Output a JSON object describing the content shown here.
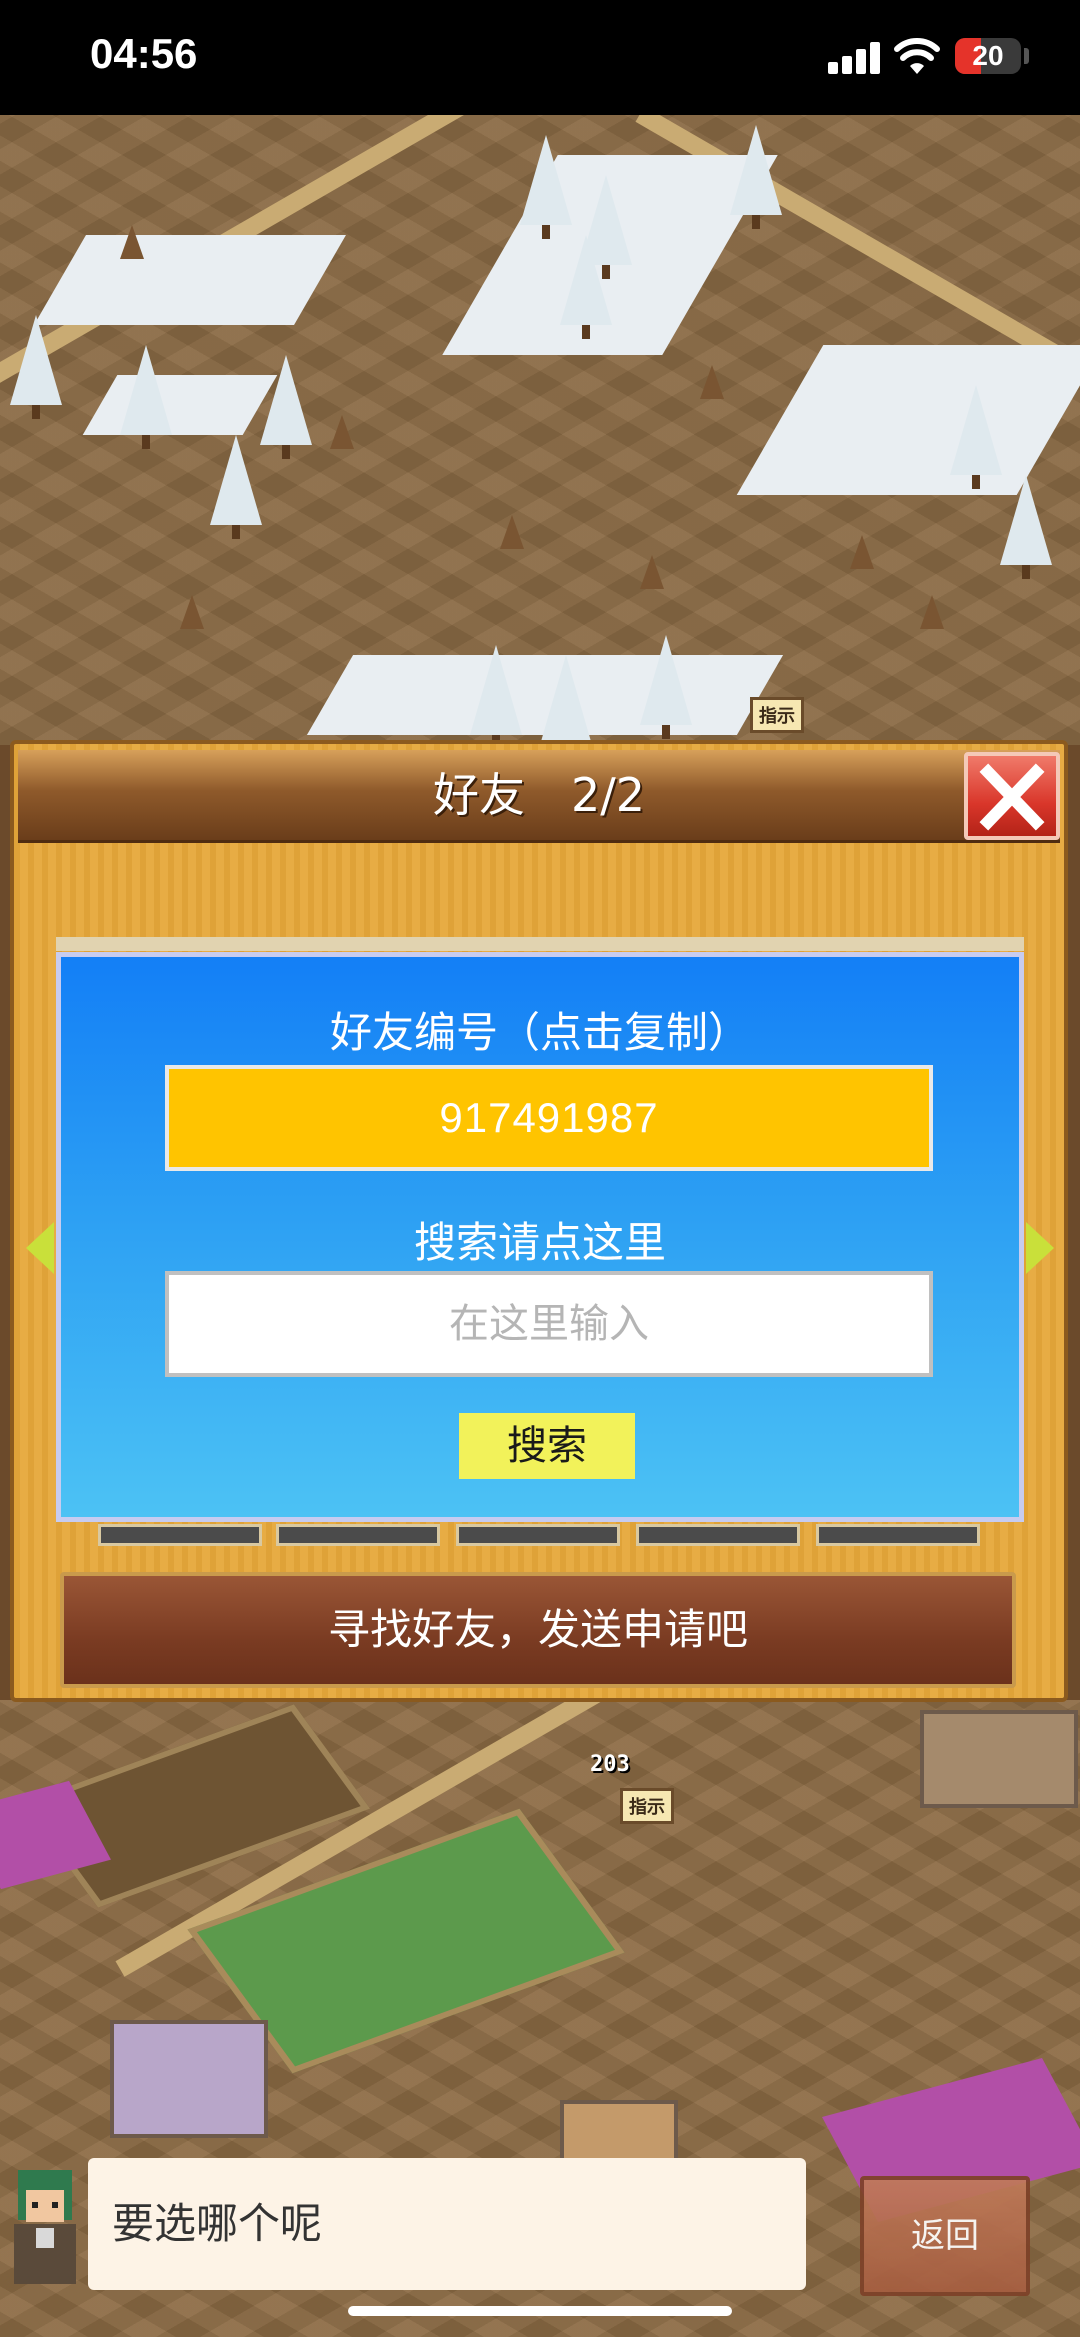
{
  "status_bar": {
    "time": "04:56",
    "battery_level": "20",
    "battery_color": "#e5332a",
    "icons": [
      "signal-icon",
      "wifi-icon",
      "battery-icon"
    ]
  },
  "map": {
    "labels": [
      "指示",
      "指示"
    ],
    "counter": "203"
  },
  "dialog": {
    "title": "好友　2/2",
    "close_icon": "close-icon",
    "friend_id_label": "好友编号（点击复制）",
    "friend_id": "917491987",
    "search_label": "搜索请点这里",
    "search_placeholder": "在这里输入",
    "search_button": "搜索",
    "find_friends_button": "寻找好友，发送申请吧",
    "colors": {
      "panel_blue": "#137ff6",
      "id_box": "#ffc400",
      "search_button": "#f2f25a"
    }
  },
  "bottom_bar": {
    "message": "要选哪个呢",
    "back_button": "返回"
  }
}
